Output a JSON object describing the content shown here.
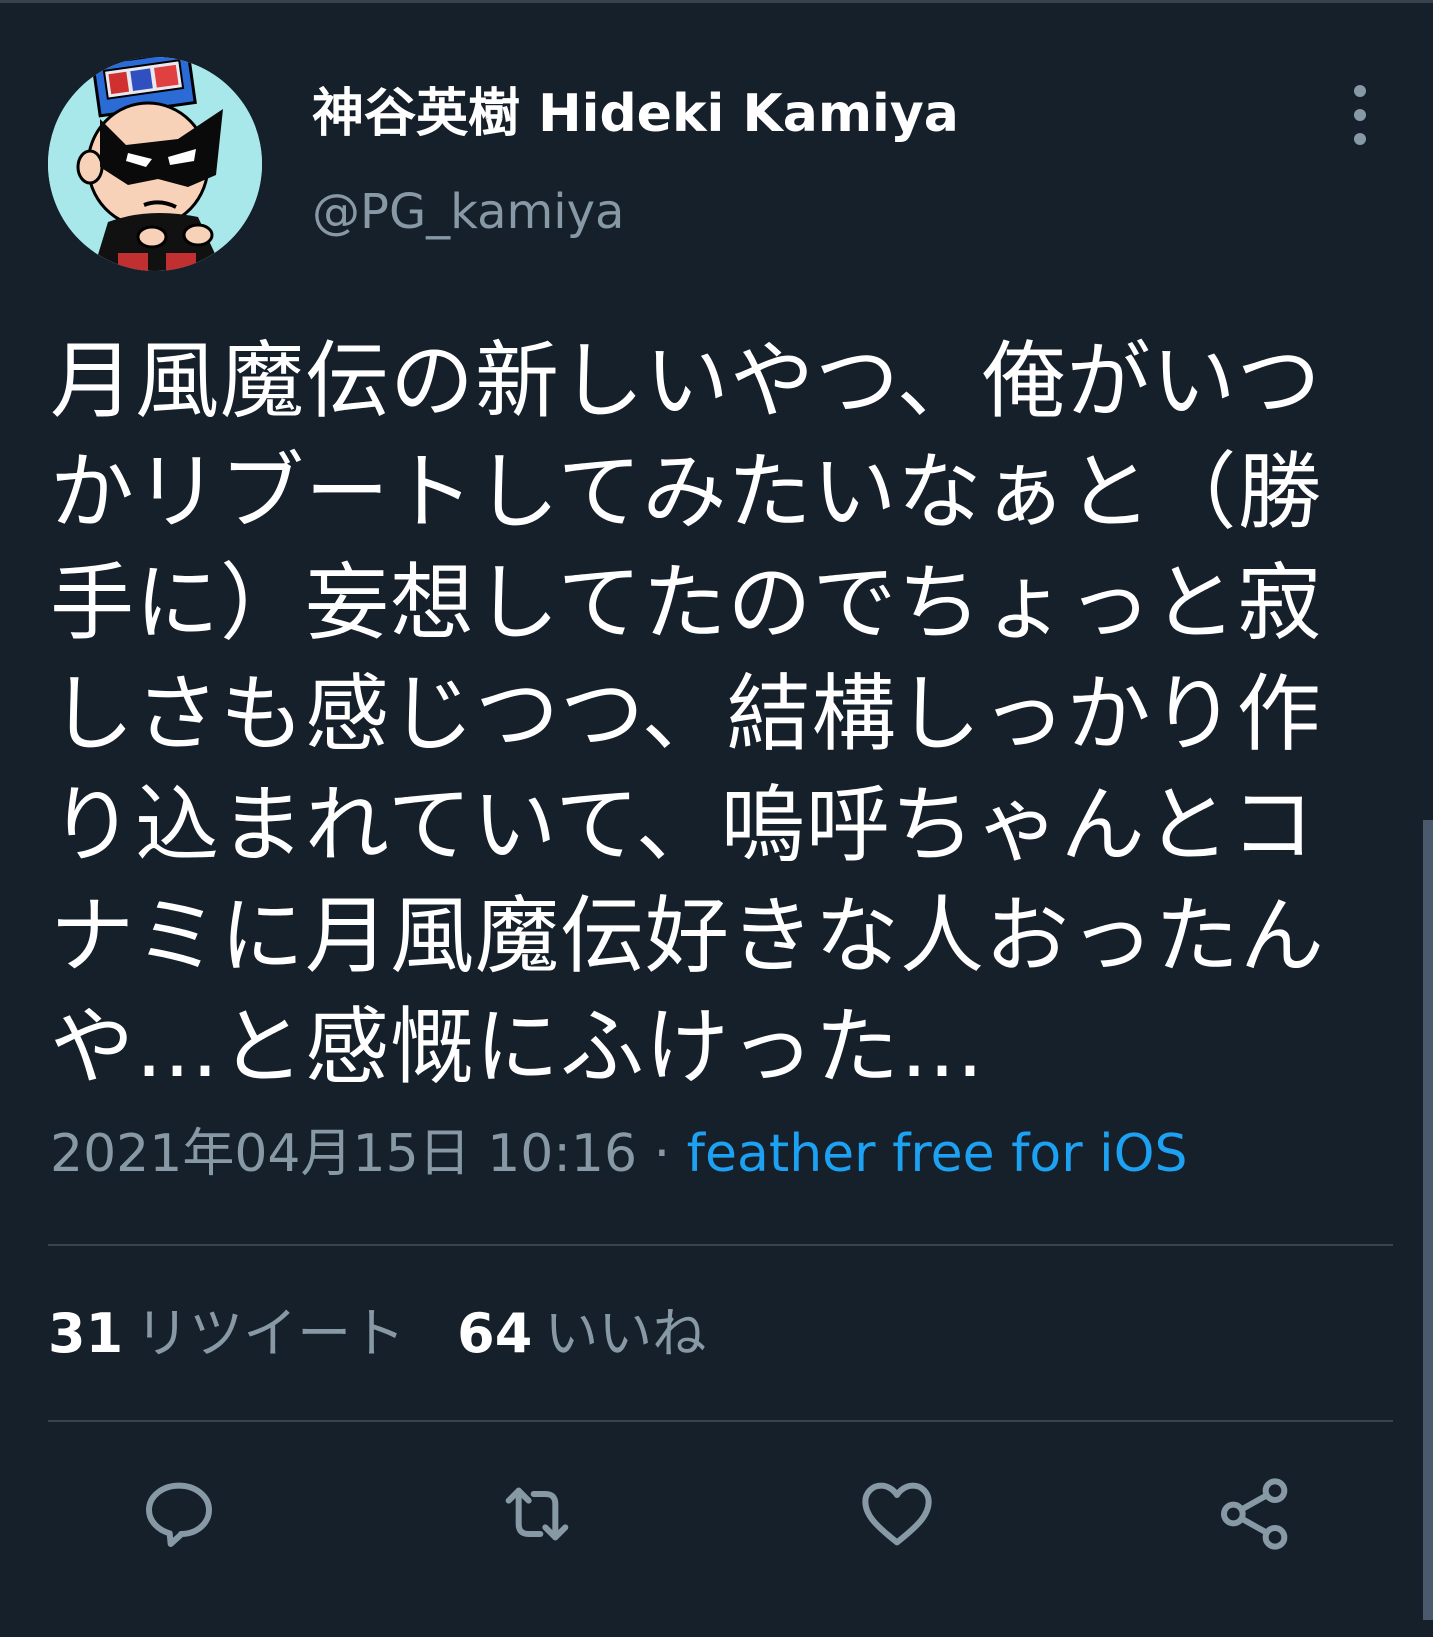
{
  "author": {
    "display_name": "神谷英樹 Hideki Kamiya",
    "handle": "@PG_kamiya",
    "avatar_icon": "cartoon-masked-character-avatar"
  },
  "tweet": {
    "text": "月風魔伝の新しいやつ、俺がいつ\nかリブートしてみたいなぁと（勝\n手に）妄想してたのでちょっと寂\nしさも感じつつ、結構しっかり作\nり込まれていて、嗚呼ちゃんとコ\nナミに月風魔伝好きな人おったん\nや…と感慨にふけった…",
    "timestamp": "2021年04月15日 10:16",
    "separator": " · ",
    "source": "feather free for iOS"
  },
  "stats": {
    "retweets_count": "31",
    "retweets_label": "リツイート",
    "likes_count": "64",
    "likes_label": "いいね"
  },
  "actions": {
    "reply_icon": "reply-icon",
    "retweet_icon": "retweet-icon",
    "like_icon": "heart-icon",
    "share_icon": "share-icon"
  },
  "colors": {
    "background": "#15202b",
    "text": "#ffffff",
    "secondary": "#8899a6",
    "accent": "#1da1f2",
    "divider": "#38444d"
  }
}
